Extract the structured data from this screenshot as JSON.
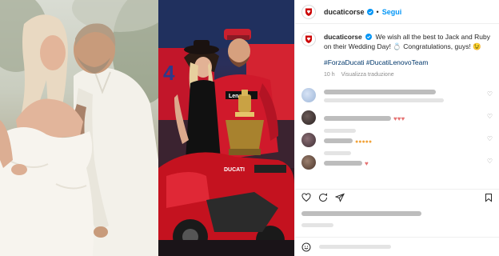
{
  "post": {
    "username": "ducaticorse",
    "follow_label": "Segui",
    "separator": "•",
    "caption_text": "We wish all the best to Jack and Ruby on their Wedding Day! 💍 Congratulations, guys! 😉",
    "hashtags": "#ForzaDucati #DucatiLenovoTeam",
    "time": "10 h",
    "translation_label": "Visualizza traduzione"
  },
  "colors": {
    "follow_blue": "#0095f6",
    "hashtag_blue": "#00376b",
    "ducati_red": "#cc0000",
    "muted_text": "#8e8e8e"
  },
  "icons": [
    "ducati-shield-icon",
    "verified-badge-icon",
    "heart-icon",
    "comment-icon",
    "share-icon",
    "bookmark-icon",
    "emoji-icon"
  ]
}
